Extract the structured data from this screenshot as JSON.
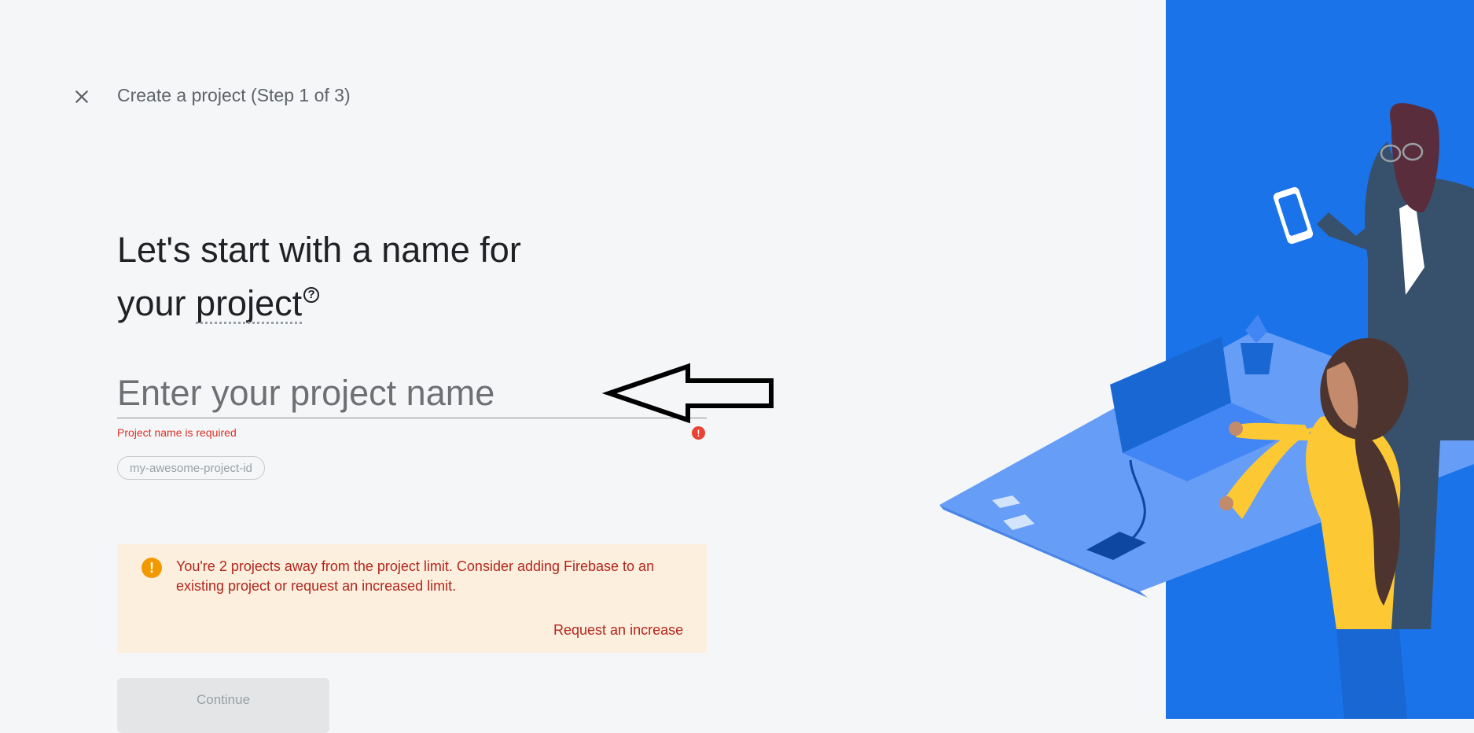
{
  "header": {
    "close_icon": "close-icon",
    "title": "Create a project (Step 1 of 3)"
  },
  "headline": {
    "line1": "Let's start with a name for",
    "line2_prefix": "your ",
    "line2_term": "project",
    "help_icon": "help-icon",
    "help_glyph": "?"
  },
  "project_name": {
    "placeholder": "Enter your project name",
    "value": "",
    "error": "Project name is required",
    "error_icon": "error-icon",
    "error_glyph": "!"
  },
  "project_id": {
    "chip": "my-awesome-project-id"
  },
  "limit_banner": {
    "icon": "warning-icon",
    "icon_glyph": "!",
    "message": "You're 2 projects away from the project limit. Consider adding Firebase to an existing project or request an increased limit.",
    "link": "Request an increase"
  },
  "actions": {
    "continue_label": "Continue"
  },
  "colors": {
    "background": "#f5f6f8",
    "illustration_blue": "#1a73e8",
    "error": "#d93025",
    "warning_bg": "#fdefdd",
    "warning_text": "#b3261e",
    "warning_icon": "#f29900"
  }
}
